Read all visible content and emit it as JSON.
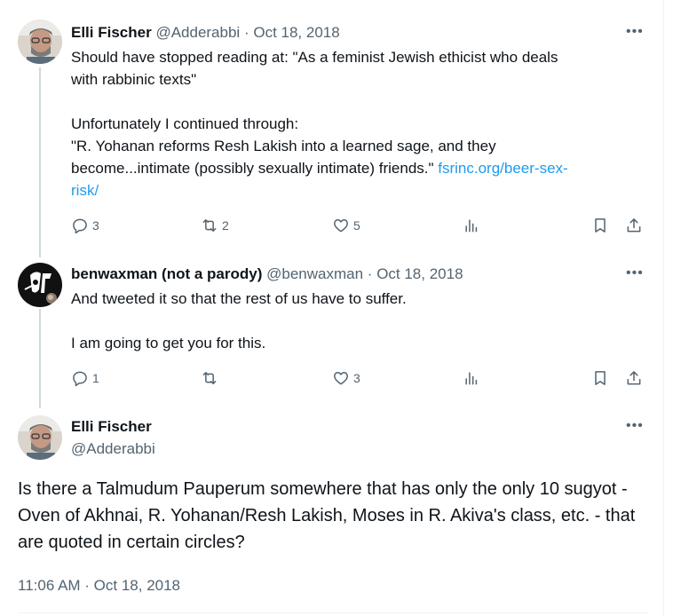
{
  "tweets": [
    {
      "name": "Elli Fischer",
      "handle": "@Adderabbi",
      "date": "Oct 18, 2018",
      "text_before_link": "Should have stopped reading at: \"As a feminist Jewish ethicist who deals\nwith rabbinic texts\"\n\nUnfortunately I continued through:\n\"R. Yohanan reforms Resh Lakish into a learned sage, and they\nbecome...intimate (possibly sexually intimate) friends.\" ",
      "link": "fsrinc.org/beer-sex-\nrisk/",
      "replies": "3",
      "retweets": "2",
      "likes": "5"
    },
    {
      "name": "benwaxman (not a parody)",
      "handle": "@benwaxman",
      "date": "Oct 18, 2018",
      "text": "And tweeted it so that the rest of us have to suffer.\n\nI am going to get you for this.",
      "replies": "1",
      "retweets": "",
      "likes": "3"
    }
  ],
  "focus": {
    "name": "Elli Fischer",
    "handle": "@Adderabbi",
    "text": "Is there a Talmudum Pauperum somewhere that has only the only 10 sugyot - Oven of Akhnai, R. Yohanan/Resh Lakish, Moses in R. Akiva's class, etc. - that are quoted in certain circles?",
    "timestamp": "11:06 AM · Oct 18, 2018"
  },
  "ui": {
    "more_glyph": "•••",
    "separator": "·"
  },
  "colors": {
    "link": "#1d9bf0",
    "muted": "#536471",
    "text": "#0f1419",
    "thread_line": "#cfd9de"
  },
  "icons": [
    "reply-icon",
    "retweet-icon",
    "like-icon",
    "views-icon",
    "bookmark-icon",
    "share-icon"
  ]
}
